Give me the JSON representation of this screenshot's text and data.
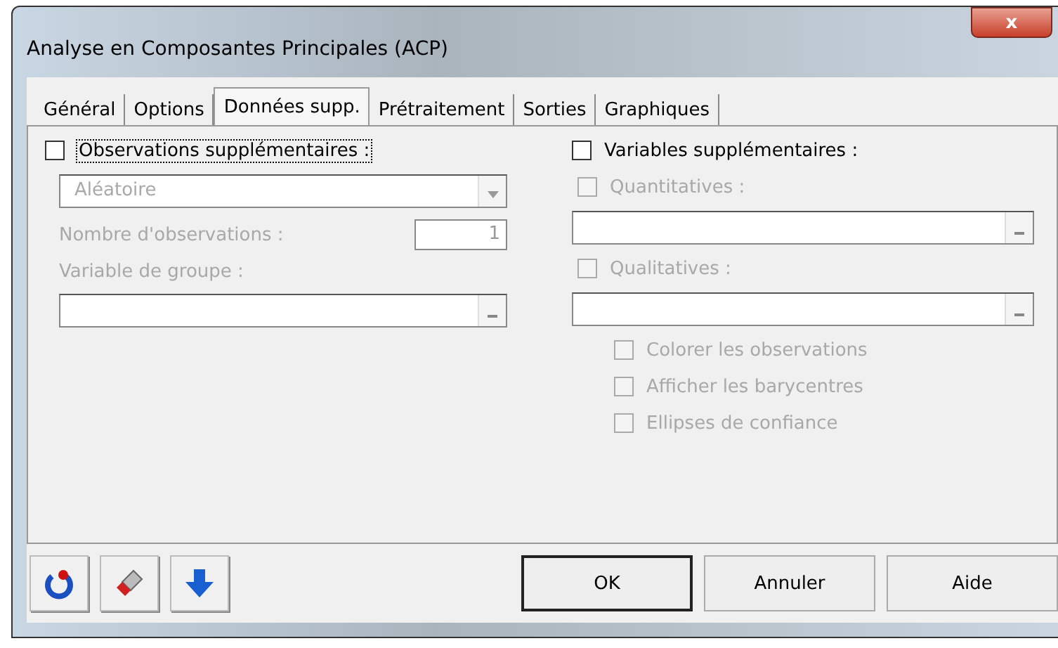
{
  "window": {
    "title": "Analyse en Composantes Principales (ACP)",
    "close": "x"
  },
  "tabs": [
    {
      "label": "Général",
      "selected": false
    },
    {
      "label": "Options",
      "selected": false
    },
    {
      "label": "Données supp.",
      "selected": true
    },
    {
      "label": "Prétraitement",
      "selected": false
    },
    {
      "label": "Sorties",
      "selected": false
    },
    {
      "label": "Graphiques",
      "selected": false
    }
  ],
  "left": {
    "observations": {
      "label": "Observations supplémentaires :",
      "checked": false,
      "focused": true
    },
    "mode_dropdown": {
      "value": "Aléatoire",
      "disabled": true
    },
    "count": {
      "label": "Nombre d'observations :",
      "value": "1",
      "disabled": true
    },
    "group": {
      "label": "Variable de groupe :",
      "disabled": true
    }
  },
  "right": {
    "variables": {
      "label": "Variables supplémentaires :",
      "checked": false
    },
    "quantitative": {
      "label": "Quantitatives :",
      "checked": false,
      "disabled": true
    },
    "qualitative": {
      "label": "Qualitatives :",
      "checked": false,
      "disabled": true
    },
    "options": [
      {
        "label": "Colorer les observations",
        "checked": false,
        "disabled": true
      },
      {
        "label": "Afficher les barycentres",
        "checked": false,
        "disabled": true
      },
      {
        "label": "Ellipses de confiance",
        "checked": false,
        "disabled": true
      }
    ]
  },
  "buttons": [
    {
      "label": "OK",
      "default": true
    },
    {
      "label": "Annuler",
      "default": false
    },
    {
      "label": "Aide",
      "default": false
    }
  ]
}
